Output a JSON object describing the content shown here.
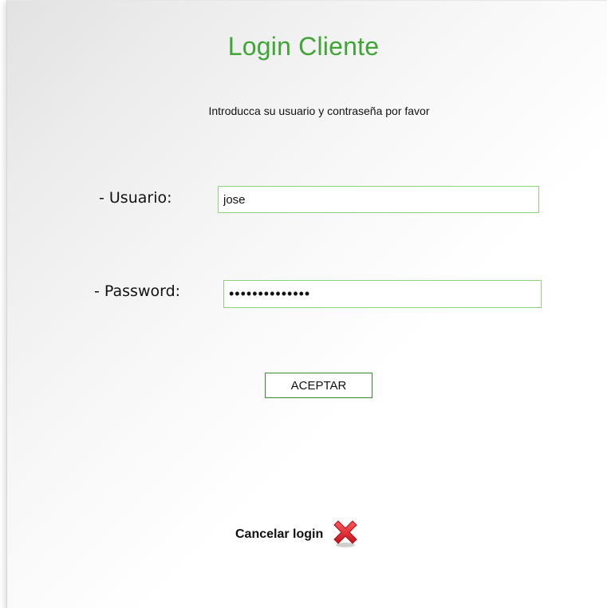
{
  "page": {
    "title": "Login Cliente",
    "subtitle": "Introducca su usuario y contraseña por favor"
  },
  "form": {
    "username_label": "- Usuario:",
    "username_value": "jose",
    "password_label": "- Password:",
    "password_value": "jose123456789a",
    "submit_label": "ACEPTAR"
  },
  "cancel": {
    "label": "Cancelar login",
    "icon": "close-icon"
  },
  "colors": {
    "title": "#3fa535",
    "field_border": "#8fd27e",
    "button_border": "#3a8a2e",
    "cancel_icon": "#e0202a"
  }
}
